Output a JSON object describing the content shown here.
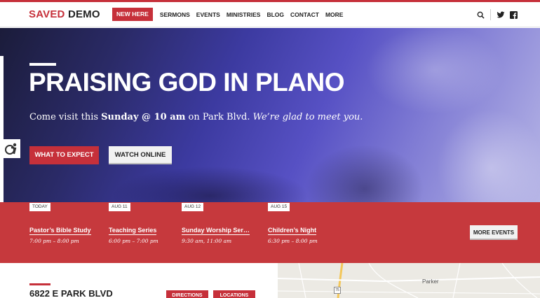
{
  "brand": {
    "logo_accent": "SAVED",
    "logo_rest": " DEMO",
    "accent_color": "#c6303a"
  },
  "nav": {
    "items": [
      {
        "label": "NEW HERE",
        "highlight": true
      },
      {
        "label": "SERMONS"
      },
      {
        "label": "EVENTS"
      },
      {
        "label": "MINISTRIES"
      },
      {
        "label": "BLOG"
      },
      {
        "label": "CONTACT"
      },
      {
        "label": "MORE"
      }
    ],
    "icons": [
      "search-icon",
      "twitter-icon",
      "facebook-icon"
    ]
  },
  "hero": {
    "title": "PRAISING GOD IN PLANO",
    "subtitle_pre": "Come visit this ",
    "subtitle_bold": "Sunday @ 10 am",
    "subtitle_mid": " on Park Blvd. ",
    "subtitle_italic": "We’re glad to meet you.",
    "primary_button": "WHAT TO EXPECT",
    "secondary_button": "WATCH ONLINE"
  },
  "events": {
    "items": [
      {
        "date": "TODAY",
        "title": "Pastor’s Bible Study",
        "time": "7:00 pm – 8:00 pm"
      },
      {
        "date": "AUG 11",
        "title": "Teaching Series",
        "time": "6:00 pm – 7:00 pm"
      },
      {
        "date": "AUG 12",
        "title": "Sunday Worship Ser…",
        "time": "9:30 am, 11:00 am"
      },
      {
        "date": "AUG 15",
        "title": "Children’s Night",
        "time": "6:30 pm – 8:00 pm"
      }
    ],
    "more_button": "MORE EVENTS"
  },
  "location": {
    "address": "6822 E PARK BLVD",
    "directions_button": "DIRECTIONS",
    "locations_button": "LOCATIONS"
  },
  "map": {
    "place_label": "Parker",
    "highway_label": "75"
  }
}
